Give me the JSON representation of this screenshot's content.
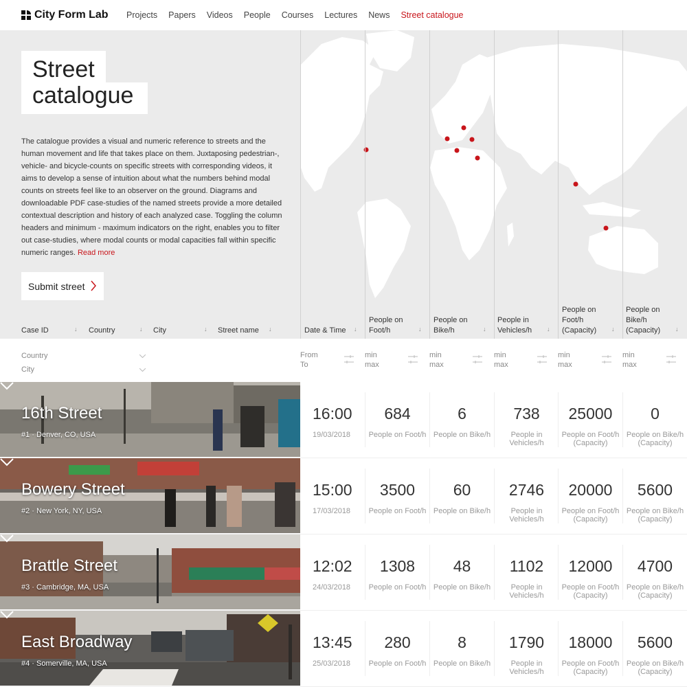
{
  "nav": {
    "brand": "City Form Lab",
    "items": [
      "Projects",
      "Papers",
      "Videos",
      "People",
      "Courses",
      "Lectures",
      "News",
      "Street catalogue"
    ],
    "active_index": 7,
    "active_color": "#c8151b"
  },
  "hero": {
    "title_line1": "Street",
    "title_line2": "catalogue",
    "description": "The catalogue provides a visual and numeric reference to streets and the human movement and life that takes place on them. Juxtaposing pedestrian-, vehicle- and bicycle-counts on specific streets with corresponding videos, it aims to develop a sense of intuition about what the numbers behind modal counts on streets feel like to an observer on the ground. Diagrams and downloadable PDF case-studies of the named streets provide a more detailed contextual description and history of each analyzed case. Toggling the column headers and minimum - maximum indicators on the right, enables you to filter out case-studies, where modal counts or modal capacities fall within specific numeric ranges.",
    "read_more": "Read more",
    "submit_label": "Submit street"
  },
  "columns": {
    "case_id": "Case ID",
    "country": "Country",
    "city": "City",
    "street_name": "Street name",
    "date_time": "Date & Time",
    "foot": [
      "People on",
      "Foot/h"
    ],
    "bike": [
      "People on",
      "Bike/h"
    ],
    "vehicles": [
      "People in",
      "Vehicles/h"
    ],
    "foot_cap": [
      "People on",
      "Foot/h",
      "(Capacity)"
    ],
    "bike_cap": [
      "People on",
      "Bike/h",
      "(Capacity)"
    ],
    "sort_arrow": "↓"
  },
  "filters": {
    "country": "Country",
    "city": "City",
    "from": "From",
    "to": "To",
    "min": "min",
    "max": "max"
  },
  "units": {
    "foot": "People on Foot/h",
    "bike": "People on Bike/h",
    "vehicles_1": "People in",
    "vehicles_2": "Vehicles/h",
    "foot_cap_1": "People on Foot/h",
    "foot_cap_2": "(Capacity)",
    "bike_cap_1": "People on Bike/h",
    "bike_cap_2": "(Capacity)"
  },
  "streets": [
    {
      "name": "16th Street",
      "sub": "#1 · Denver, CO, USA",
      "time": "16:00",
      "date": "19/03/2018",
      "foot": "684",
      "bike": "6",
      "vehicles": "738",
      "foot_cap": "25000",
      "bike_cap": "0"
    },
    {
      "name": "Bowery Street",
      "sub": "#2 · New York, NY, USA",
      "time": "15:00",
      "date": "17/03/2018",
      "foot": "3500",
      "bike": "60",
      "vehicles": "2746",
      "foot_cap": "20000",
      "bike_cap": "5600"
    },
    {
      "name": "Brattle Street",
      "sub": "#3 · Cambridge, MA, USA",
      "time": "12:02",
      "date": "24/03/2018",
      "foot": "1308",
      "bike": "48",
      "vehicles": "1102",
      "foot_cap": "12000",
      "bike_cap": "4700"
    },
    {
      "name": "East Broadway",
      "sub": "#4 · Somerville, MA, USA",
      "time": "13:45",
      "date": "25/03/2018",
      "foot": "280",
      "bike": "8",
      "vehicles": "1790",
      "foot_cap": "18000",
      "bike_cap": "5600"
    }
  ],
  "icons": {
    "logo": "grid-logo-icon",
    "submit": "chevron-right-icon",
    "row": "chevron-down-icon",
    "filter": "slider-icon",
    "dropdown": "chevron-down-icon"
  },
  "map_marker_color": "#c8151b"
}
